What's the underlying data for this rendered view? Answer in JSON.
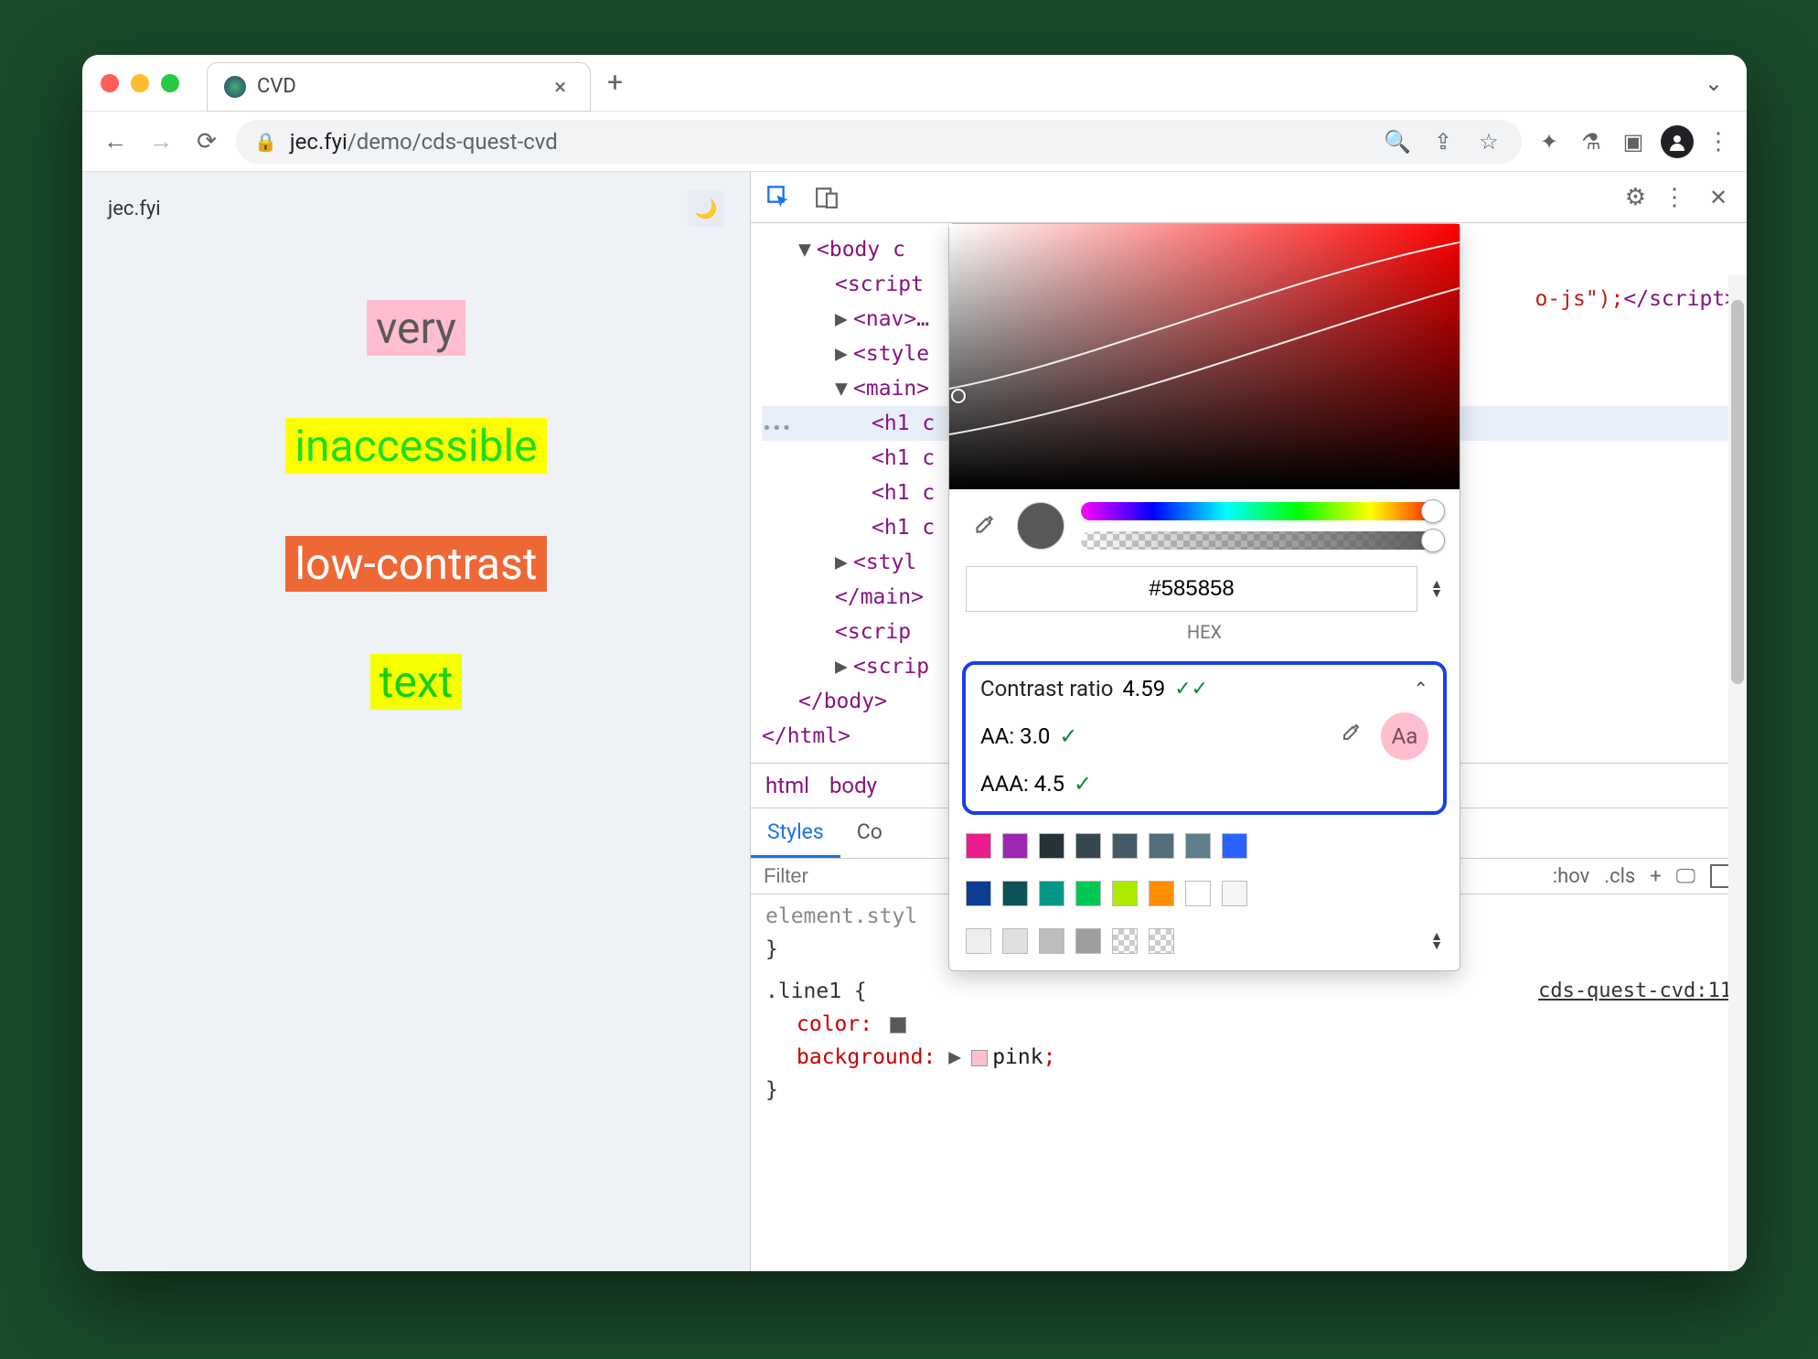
{
  "browser": {
    "tab_title": "CVD",
    "url_host": "jec.fyi",
    "url_path": "/demo/cds-quest-cvd"
  },
  "page": {
    "site_name": "jec.fyi",
    "lines": {
      "line1": "very",
      "line2": "inaccessible",
      "line3": "low-contrast",
      "line4": "text"
    }
  },
  "devtools": {
    "script_fragment": "o-js\");",
    "dom": {
      "body_open": "<body c",
      "script1": "<script",
      "nav": "<nav>…",
      "style1": "<style",
      "main_open": "<main>",
      "h1a": "<h1 c",
      "h1b": "<h1 c",
      "h1c": "<h1 c",
      "h1d": "<h1 c",
      "style2": "<styl",
      "main_close": "</main>",
      "script2": "<scrip",
      "script3": "<scrip",
      "body_close": "</body>",
      "html_close": "</html>"
    },
    "breadcrumb": {
      "a": "html",
      "b": "body"
    },
    "tabs": {
      "styles": "Styles",
      "computed_partial": "Co"
    },
    "filter_placeholder": "Filter",
    "filter_hov": ":hov",
    "filter_cls": ".cls",
    "styles": {
      "elem_style": "element.styl",
      "rule_selector": ".line1 {",
      "prop_color": "color",
      "prop_bg": "background",
      "val_bg": "pink",
      "close": "}",
      "source": "cds-quest-cvd:11"
    }
  },
  "picker": {
    "hex_value": "#585858",
    "hex_label": "HEX",
    "contrast": {
      "label": "Contrast ratio",
      "value": "4.59",
      "aa_label": "AA: 3.0",
      "aaa_label": "AAA: 4.5",
      "badge": "Aa"
    },
    "palette_colors": [
      "#e91e8c",
      "#9c27b0",
      "#263238",
      "#37474f",
      "#455a64",
      "#546e7a",
      "#607d8b",
      "#2962ff",
      "#0b3d91",
      "#0d5257",
      "#009688",
      "#00c853",
      "#aeea00",
      "#ff8f00",
      "#ffffff",
      "#f5f5f5",
      "#eeeeee",
      "#e0e0e0",
      "#bdbdbd",
      "#9e9e9e",
      "#616161",
      "#212121"
    ]
  }
}
